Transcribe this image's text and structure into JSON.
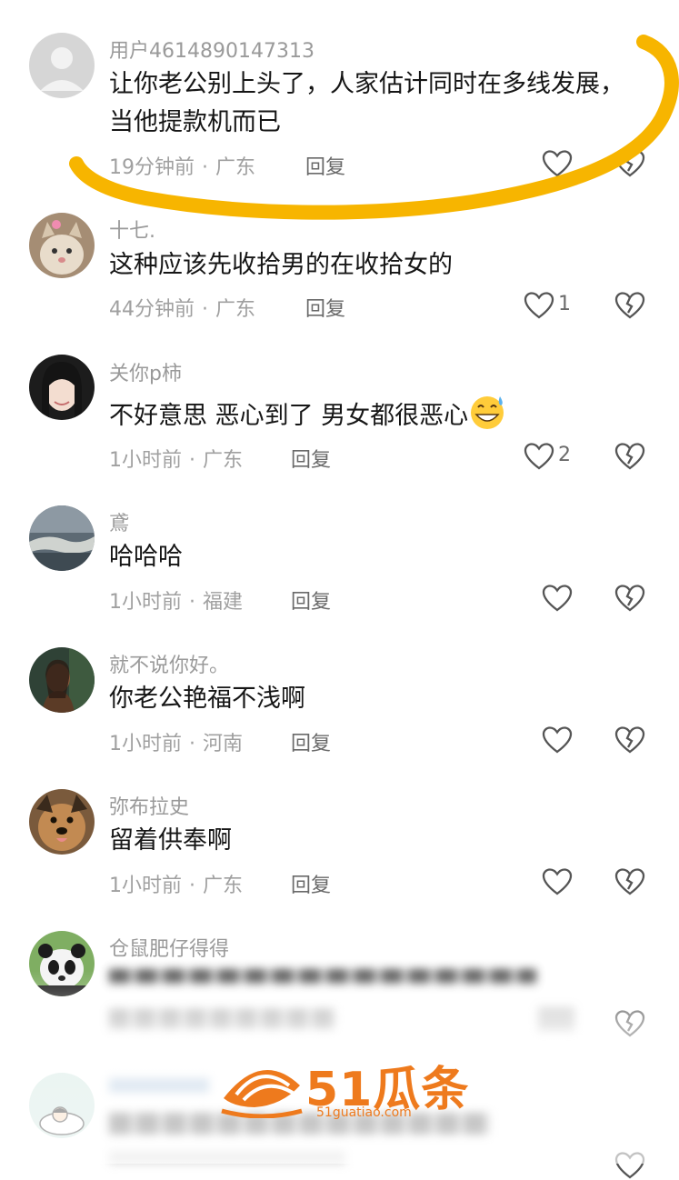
{
  "comments": [
    {
      "username": "用户4614890147313",
      "text": "让你老公别上头了，人家估计同时在多线发展，当他提款机而已",
      "time": "19分钟前",
      "location": "广东",
      "reply_label": "回复",
      "likes": "",
      "avatar": "default-avatar"
    },
    {
      "username": "十七.",
      "text": "这种应该先收拾男的在收拾女的",
      "time": "44分钟前",
      "location": "广东",
      "reply_label": "回复",
      "likes": "1",
      "avatar": "cat-avatar"
    },
    {
      "username": "关你p柿",
      "text": "不好意思 恶心到了 男女都很恶心",
      "time": "1小时前",
      "location": "广东",
      "reply_label": "回复",
      "likes": "2",
      "avatar": "girl-avatar",
      "emoji": "grinning-sweat-emoji"
    },
    {
      "username": "鳶",
      "text": "哈哈哈",
      "time": "1小时前",
      "location": "福建",
      "reply_label": "回复",
      "likes": "",
      "avatar": "sky-avatar"
    },
    {
      "username": "就不说你好。",
      "text": "你老公艳福不浅啊",
      "time": "1小时前",
      "location": "河南",
      "reply_label": "回复",
      "likes": "",
      "avatar": "man-avatar"
    },
    {
      "username": "弥布拉史",
      "text": "留着供奉啊",
      "time": "1小时前",
      "location": "广东",
      "reply_label": "回复",
      "likes": "",
      "avatar": "dog-avatar"
    },
    {
      "username": "仓鼠肥仔得得",
      "text": "",
      "avatar": "panda-avatar"
    }
  ],
  "watermark": {
    "title": "51瓜条",
    "url": "51guatiao.com"
  },
  "colors": {
    "highlight_stroke": "#f7b500",
    "watermark": "#ee7a1d",
    "meta_text": "#a0a0a0",
    "body_text": "#161616"
  }
}
